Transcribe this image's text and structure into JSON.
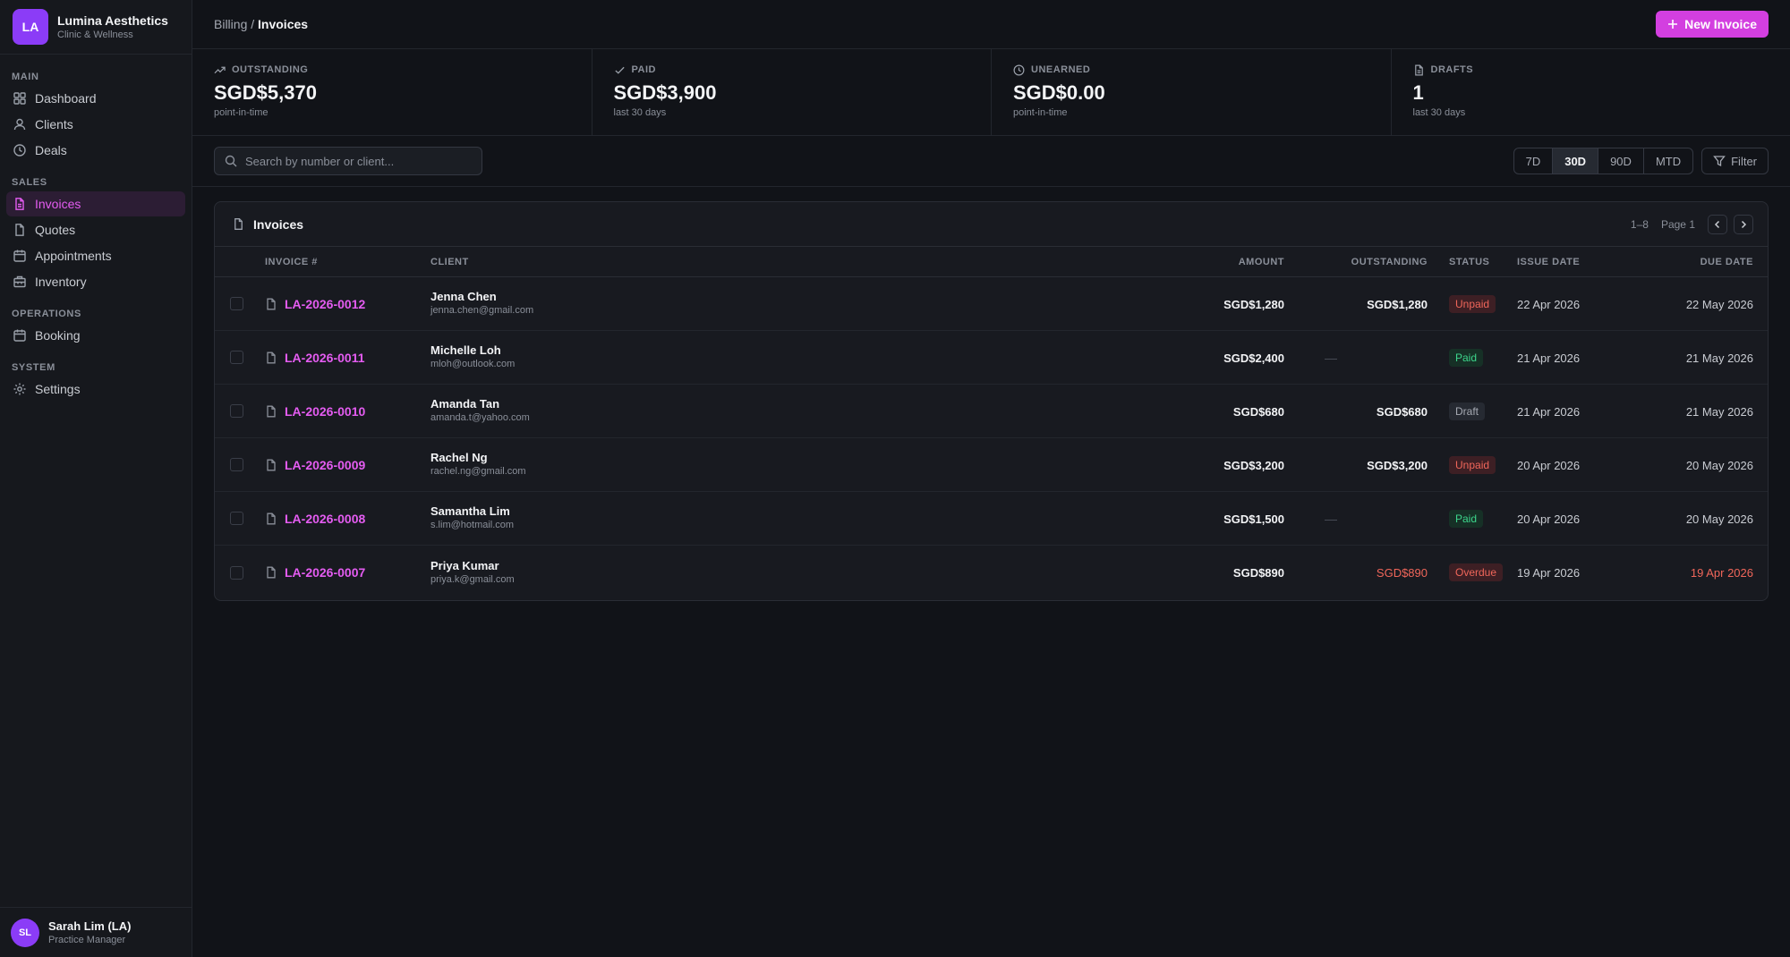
{
  "brand": {
    "initials": "LA",
    "name": "Lumina Aesthetics",
    "subtitle": "Clinic & Wellness",
    "accent": "#8b3cf7"
  },
  "sidebar": {
    "sections": [
      {
        "title": "MAIN",
        "items": [
          {
            "label": "Dashboard",
            "icon": "grid-icon"
          },
          {
            "label": "Clients",
            "icon": "user-icon"
          },
          {
            "label": "Deals",
            "icon": "clock-icon"
          }
        ]
      },
      {
        "title": "SALES",
        "items": [
          {
            "label": "Invoices",
            "icon": "file-icon",
            "active": true
          },
          {
            "label": "Quotes",
            "icon": "file-icon"
          },
          {
            "label": "Appointments",
            "icon": "calendar-icon"
          },
          {
            "label": "Inventory",
            "icon": "box-icon"
          }
        ]
      },
      {
        "title": "OPERATIONS",
        "items": [
          {
            "label": "Booking",
            "icon": "calendar-icon"
          }
        ]
      },
      {
        "title": "SYSTEM",
        "items": [
          {
            "label": "Settings",
            "icon": "gear-icon"
          }
        ]
      }
    ]
  },
  "user": {
    "initials": "SL",
    "name": "Sarah Lim (LA)",
    "role": "Practice Manager"
  },
  "header": {
    "breadcrumb_parent": "Billing",
    "separator": " / ",
    "breadcrumb_current": "Invoices",
    "new_button": "New Invoice",
    "accent": "#d33fe0"
  },
  "stats": [
    {
      "label": "OUTSTANDING",
      "value": "SGD$5,370",
      "sub": "point-in-time",
      "icon": "trending-up-icon"
    },
    {
      "label": "PAID",
      "value": "SGD$3,900",
      "sub": "last 30 days",
      "icon": "check-icon"
    },
    {
      "label": "UNEARNED",
      "value": "SGD$0.00",
      "sub": "point-in-time",
      "icon": "clock-icon"
    },
    {
      "label": "DRAFTS",
      "value": "1",
      "sub": "last 30 days",
      "icon": "file-icon"
    }
  ],
  "toolbar": {
    "search_placeholder": "Search by number or client...",
    "ranges": [
      "7D",
      "30D",
      "90D",
      "MTD"
    ],
    "active_range": "30D",
    "filter_label": "Filter"
  },
  "table": {
    "title": "Invoices",
    "range_text": "1–8",
    "page_text": "Page 1",
    "columns": {
      "number": "INVOICE #",
      "client": "CLIENT",
      "amount": "AMOUNT",
      "outstanding": "OUTSTANDING",
      "status": "STATUS",
      "issue": "ISSUE DATE",
      "due": "DUE DATE"
    },
    "rows": [
      {
        "number": "LA-2026-0012",
        "client": "Jenna Chen",
        "email": "jenna.chen@gmail.com",
        "amount": "SGD$1,280",
        "outstanding": "SGD$1,280",
        "status": "Unpaid",
        "issue": "22 Apr 2026",
        "due": "22 May 2026"
      },
      {
        "number": "LA-2026-0011",
        "client": "Michelle Loh",
        "email": "mloh@outlook.com",
        "amount": "SGD$2,400",
        "outstanding": "—",
        "status": "Paid",
        "issue": "21 Apr 2026",
        "due": "21 May 2026"
      },
      {
        "number": "LA-2026-0010",
        "client": "Amanda Tan",
        "email": "amanda.t@yahoo.com",
        "amount": "SGD$680",
        "outstanding": "SGD$680",
        "status": "Draft",
        "issue": "21 Apr 2026",
        "due": "21 May 2026"
      },
      {
        "number": "LA-2026-0009",
        "client": "Rachel Ng",
        "email": "rachel.ng@gmail.com",
        "amount": "SGD$3,200",
        "outstanding": "SGD$3,200",
        "status": "Unpaid",
        "issue": "20 Apr 2026",
        "due": "20 May 2026"
      },
      {
        "number": "LA-2026-0008",
        "client": "Samantha Lim",
        "email": "s.lim@hotmail.com",
        "amount": "SGD$1,500",
        "outstanding": "—",
        "status": "Paid",
        "issue": "20 Apr 2026",
        "due": "20 May 2026"
      },
      {
        "number": "LA-2026-0007",
        "client": "Priya Kumar",
        "email": "priya.k@gmail.com",
        "amount": "SGD$890",
        "outstanding": "SGD$890",
        "status": "Overdue",
        "issue": "19 Apr 2026",
        "due": "19 Apr 2026"
      }
    ]
  }
}
